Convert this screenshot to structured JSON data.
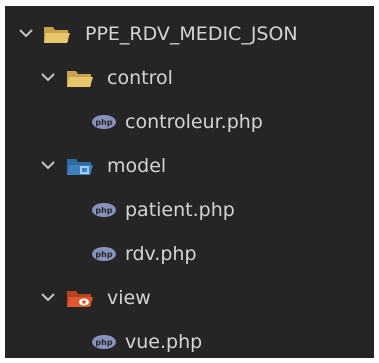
{
  "explorer": {
    "root": {
      "label": "PPE_RDV_MEDIC_JSON",
      "expanded": true,
      "icon": "folder-open-icon"
    },
    "folders": [
      {
        "label": "control",
        "expanded": true,
        "icon": "folder-open-icon",
        "files": [
          {
            "label": "controleur.php",
            "icon": "php-file-icon"
          }
        ]
      },
      {
        "label": "model",
        "expanded": true,
        "icon": "model-folder-icon",
        "files": [
          {
            "label": "patient.php",
            "icon": "php-file-icon"
          },
          {
            "label": "rdv.php",
            "icon": "php-file-icon"
          }
        ]
      },
      {
        "label": "view",
        "expanded": true,
        "icon": "view-folder-icon",
        "files": [
          {
            "label": "vue.php",
            "icon": "php-file-icon"
          }
        ]
      }
    ]
  },
  "colors": {
    "background": "#252526",
    "text": "#d4d4d4",
    "chevron": "#c5c5c5",
    "folder": "#e8c66a",
    "model_folder": "#3f7fc0",
    "view_folder": "#e2572c",
    "php_icon": "#8892bf"
  }
}
